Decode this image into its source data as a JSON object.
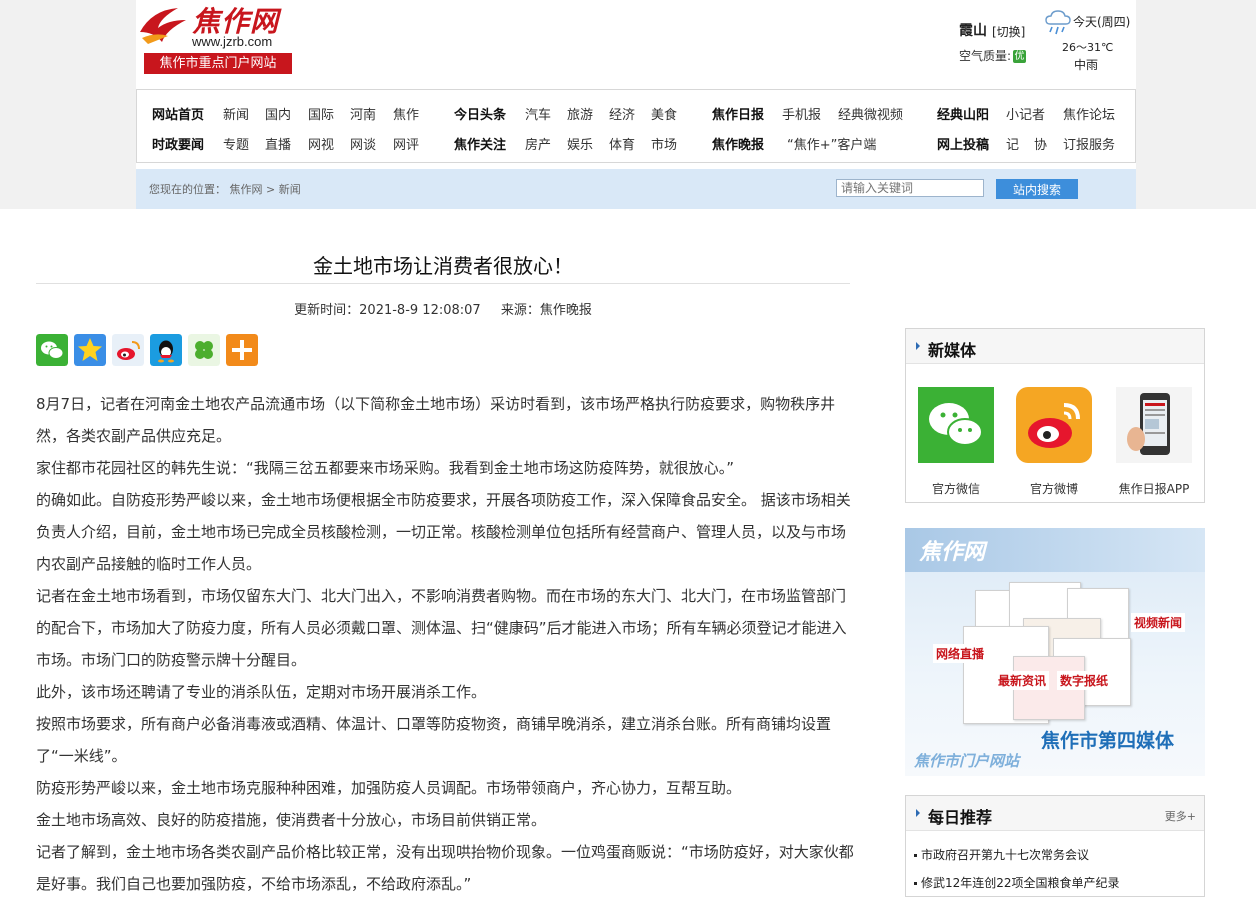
{
  "header": {
    "logo_text": "焦作网",
    "logo_url": "www.jzrb.com",
    "slogan": "焦作市重点门户网站",
    "city": "霞山",
    "switch_label": "[切换]",
    "air_label": "空气质量:",
    "air_badge": "优",
    "weather_today": "今天(周四)",
    "weather_temp": "26～31℃",
    "weather_cond": "中雨"
  },
  "nav": {
    "row1": [
      "网站首页",
      "新闻",
      "国内",
      "国际",
      "河南",
      "焦作",
      "今日头条",
      "汽车",
      "旅游",
      "经济",
      "美食",
      "焦作日报",
      "手机报",
      "经典微视频",
      "经典山阳",
      "小记者",
      "焦作论坛"
    ],
    "row2": [
      "时政要闻",
      "专题",
      "直播",
      "网视",
      "网谈",
      "网评",
      "焦作关注",
      "房产",
      "娱乐",
      "体育",
      "市场",
      "焦作晚报",
      "“焦作+”客户端",
      "网上投稿",
      "记",
      "协",
      "订报服务"
    ]
  },
  "location": {
    "prefix": "您现在的位置：",
    "crumb1": "焦作网",
    "sep": ">",
    "crumb2": "新闻"
  },
  "search": {
    "placeholder": "请输入关键词",
    "button": "站内搜索"
  },
  "article": {
    "title": "金土地市场让消费者很放心！",
    "update_time": "更新时间：2021-8-9 12:08:07",
    "source": "来源：焦作晚报",
    "paragraphs": [
      "8月7日，记者在河南金土地农产品流通市场（以下简称金土地市场）采访时看到，该市场严格执行防疫要求，购物秩序井然，各类农副产品供应充足。",
      "  家住都市花园社区的韩先生说：“我隔三岔五都要来市场采购。我看到金土地市场这防疫阵势，就很放心。”",
      "  的确如此。自防疫形势严峻以来，金土地市场便根据全市防疫要求，开展各项防疫工作，深入保障食品安全。 据该市场相关负责人介绍，目前，金土地市场已完成全员核酸检测，一切正常。核酸检测单位包括所有经营商户、管理人员，以及与市场内农副产品接触的临时工作人员。",
      "  记者在金土地市场看到，市场仅留东大门、北大门出入，不影响消费者购物。而在市场的东大门、北大门，在市场监管部门的配合下，市场加大了防疫力度，所有人员必须戴口罩、测体温、扫“健康码”后才能进入市场；所有车辆必须登记才能进入市场。市场门口的防疫警示牌十分醒目。",
      "  此外，该市场还聘请了专业的消杀队伍，定期对市场开展消杀工作。",
      "  按照市场要求，所有商户必备消毒液或酒精、体温计、口罩等防疫物资，商铺早晚消杀，建立消杀台账。所有商铺均设置了“一米线”。",
      "  防疫形势严峻以来，金土地市场克服种种困难，加强防疫人员调配。市场带领商户，齐心协力，互帮互助。",
      "  金土地市场高效、良好的防疫措施，使消费者十分放心，市场目前供销正常。",
      "  记者了解到，金土地市场各类农副产品价格比较正常，没有出现哄抬物价现象。一位鸡蛋商贩说：“市场防疫好，对大家伙都是好事。我们自己也要加强防疫，不给市场添乱，不给政府添乱。”"
    ]
  },
  "share_icons": [
    "wechat-icon",
    "qzone-icon",
    "weibo-icon",
    "qq-icon",
    "clover-icon",
    "plus-icon"
  ],
  "sidebar": {
    "new_media": {
      "title": "新媒体",
      "items": [
        {
          "label": "官方微信",
          "icon": "wechat-icon"
        },
        {
          "label": "官方微博",
          "icon": "weibo-icon"
        },
        {
          "label": "焦作日报APP",
          "icon": "phone-icon"
        }
      ]
    },
    "banner": {
      "logo": "焦作网",
      "tag_live": "网络直播",
      "tag_video": "视频新闻",
      "tag_news": "最新资讯",
      "tag_paper": "数字报纸",
      "main": "焦作市第四媒体",
      "sub": "焦作市门户网站"
    },
    "daily": {
      "title": "每日推荐",
      "more": "更多+",
      "items": [
        "市政府召开第九十七次常务会议",
        "修武12年连创22项全国粮食单产纪录"
      ]
    }
  },
  "colors": {
    "brand_red": "#c8161d",
    "nav_blue_bg": "#d9e8f7",
    "search_button": "#3d8edb",
    "banner_blue": "#1f6fb8"
  }
}
